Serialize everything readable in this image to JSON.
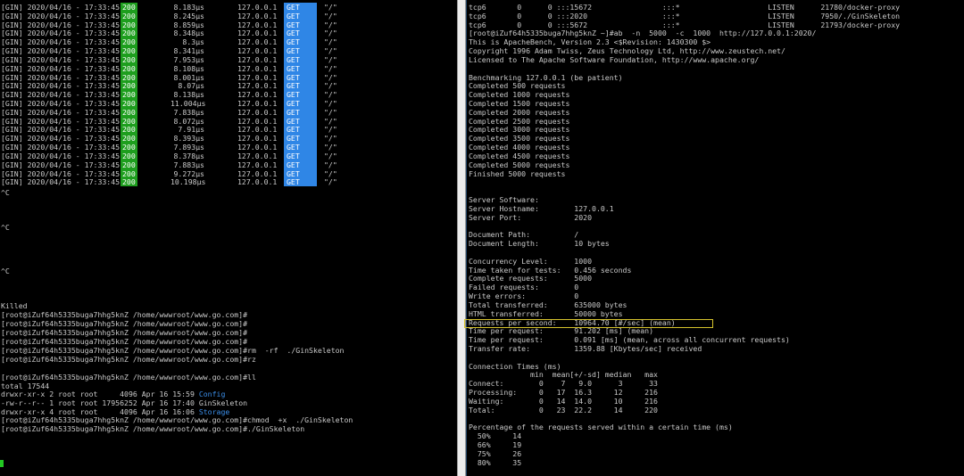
{
  "left_pane": {
    "gin_rows": [
      {
        "prefix": "[GIN] 2020/04/16 - 17:33:45 |",
        "status": "200",
        "latency": "8.183µs",
        "ip": "127.0.0.1",
        "method": "GET",
        "path": "\"/\""
      },
      {
        "prefix": "[GIN] 2020/04/16 - 17:33:45 |",
        "status": "200",
        "latency": "8.245µs",
        "ip": "127.0.0.1",
        "method": "GET",
        "path": "\"/\""
      },
      {
        "prefix": "[GIN] 2020/04/16 - 17:33:45 |",
        "status": "200",
        "latency": "8.859µs",
        "ip": "127.0.0.1",
        "method": "GET",
        "path": "\"/\""
      },
      {
        "prefix": "[GIN] 2020/04/16 - 17:33:45 |",
        "status": "200",
        "latency": "8.348µs",
        "ip": "127.0.0.1",
        "method": "GET",
        "path": "\"/\""
      },
      {
        "prefix": "[GIN] 2020/04/16 - 17:33:45 |",
        "status": "200",
        "latency": "8.3µs",
        "ip": "127.0.0.1",
        "method": "GET",
        "path": "\"/\""
      },
      {
        "prefix": "[GIN] 2020/04/16 - 17:33:45 |",
        "status": "200",
        "latency": "8.341µs",
        "ip": "127.0.0.1",
        "method": "GET",
        "path": "\"/\""
      },
      {
        "prefix": "[GIN] 2020/04/16 - 17:33:45 |",
        "status": "200",
        "latency": "7.953µs",
        "ip": "127.0.0.1",
        "method": "GET",
        "path": "\"/\""
      },
      {
        "prefix": "[GIN] 2020/04/16 - 17:33:45 |",
        "status": "200",
        "latency": "8.108µs",
        "ip": "127.0.0.1",
        "method": "GET",
        "path": "\"/\""
      },
      {
        "prefix": "[GIN] 2020/04/16 - 17:33:45 |",
        "status": "200",
        "latency": "8.001µs",
        "ip": "127.0.0.1",
        "method": "GET",
        "path": "\"/\""
      },
      {
        "prefix": "[GIN] 2020/04/16 - 17:33:45 |",
        "status": "200",
        "latency": "8.07µs",
        "ip": "127.0.0.1",
        "method": "GET",
        "path": "\"/\""
      },
      {
        "prefix": "[GIN] 2020/04/16 - 17:33:45 |",
        "status": "200",
        "latency": "8.138µs",
        "ip": "127.0.0.1",
        "method": "GET",
        "path": "\"/\""
      },
      {
        "prefix": "[GIN] 2020/04/16 - 17:33:45 |",
        "status": "200",
        "latency": "11.004µs",
        "ip": "127.0.0.1",
        "method": "GET",
        "path": "\"/\""
      },
      {
        "prefix": "[GIN] 2020/04/16 - 17:33:45 |",
        "status": "200",
        "latency": "7.838µs",
        "ip": "127.0.0.1",
        "method": "GET",
        "path": "\"/\""
      },
      {
        "prefix": "[GIN] 2020/04/16 - 17:33:45 |",
        "status": "200",
        "latency": "8.072µs",
        "ip": "127.0.0.1",
        "method": "GET",
        "path": "\"/\""
      },
      {
        "prefix": "[GIN] 2020/04/16 - 17:33:45 |",
        "status": "200",
        "latency": "7.91µs",
        "ip": "127.0.0.1",
        "method": "GET",
        "path": "\"/\""
      },
      {
        "prefix": "[GIN] 2020/04/16 - 17:33:45 |",
        "status": "200",
        "latency": "8.393µs",
        "ip": "127.0.0.1",
        "method": "GET",
        "path": "\"/\""
      },
      {
        "prefix": "[GIN] 2020/04/16 - 17:33:45 |",
        "status": "200",
        "latency": "7.893µs",
        "ip": "127.0.0.1",
        "method": "GET",
        "path": "\"/\""
      },
      {
        "prefix": "[GIN] 2020/04/16 - 17:33:45 |",
        "status": "200",
        "latency": "8.378µs",
        "ip": "127.0.0.1",
        "method": "GET",
        "path": "\"/\""
      },
      {
        "prefix": "[GIN] 2020/04/16 - 17:33:45 |",
        "status": "200",
        "latency": "7.883µs",
        "ip": "127.0.0.1",
        "method": "GET",
        "path": "\"/\""
      },
      {
        "prefix": "[GIN] 2020/04/16 - 17:33:45 |",
        "status": "200",
        "latency": "9.272µs",
        "ip": "127.0.0.1",
        "method": "GET",
        "path": "\"/\""
      },
      {
        "prefix": "[GIN] 2020/04/16 - 17:33:45 |",
        "status": "200",
        "latency": "10.198µs",
        "ip": "127.0.0.1",
        "method": "GET",
        "path": "\"/\""
      }
    ],
    "interrupt_1": "^C",
    "interrupt_2": "^C",
    "interrupt_3": "^C",
    "killed": "Killed",
    "prompts": [
      "[root@iZuf64h5335buga7hhg5knZ /home/wwwroot/www.go.com]#",
      "[root@iZuf64h5335buga7hhg5knZ /home/wwwroot/www.go.com]#",
      "[root@iZuf64h5335buga7hhg5knZ /home/wwwroot/www.go.com]#",
      "[root@iZuf64h5335buga7hhg5knZ /home/wwwroot/www.go.com]#",
      "[root@iZuf64h5335buga7hhg5knZ /home/wwwroot/www.go.com]#rm  -rf  ./GinSkeleton",
      "[root@iZuf64h5335buga7hhg5knZ /home/wwwroot/www.go.com]#rz"
    ],
    "ll_prompt": "[root@iZuf64h5335buga7hhg5knZ /home/wwwroot/www.go.com]#ll",
    "total": "total 17544",
    "listing": [
      {
        "meta": "drwxr-xr-x 2 root root     4096 Apr 16 15:59 ",
        "name": "Config"
      },
      {
        "meta": "-rw-r--r-- 1 root root 17956252 Apr 16 17:40 ",
        "name": "GinSkeleton"
      },
      {
        "meta": "drwxr-xr-x 4 root root     4096 Apr 16 16:06 ",
        "name": "Storage"
      }
    ],
    "chmod_prompt": "[root@iZuf64h5335buga7hhg5knZ /home/wwwroot/www.go.com]#chmod  +x  ./GinSkeleton",
    "run_prompt": "[root@iZuf64h5335buga7hhg5knZ /home/wwwroot/www.go.com]#./GinSkeleton"
  },
  "right_pane": {
    "lines": [
      "tcp6       0      0 :::15672                :::*                    LISTEN      21780/docker-proxy",
      "tcp6       0      0 :::2020                 :::*                    LISTEN      7950/./GinSkeleton",
      "tcp6       0      0 :::5672                 :::*                    LISTEN      21793/docker-proxy",
      "[root@iZuf64h5335buga7hhg5knZ ~]#ab  -n  5000  -c  1000  http://127.0.0.1:2020/",
      "This is ApacheBench, Version 2.3 <$Revision: 1430300 $>",
      "Copyright 1996 Adam Twiss, Zeus Technology Ltd, http://www.zeustech.net/",
      "Licensed to The Apache Software Foundation, http://www.apache.org/",
      "",
      "Benchmarking 127.0.0.1 (be patient)",
      "Completed 500 requests",
      "Completed 1000 requests",
      "Completed 1500 requests",
      "Completed 2000 requests",
      "Completed 2500 requests",
      "Completed 3000 requests",
      "Completed 3500 requests",
      "Completed 4000 requests",
      "Completed 4500 requests",
      "Completed 5000 requests",
      "Finished 5000 requests",
      "",
      "",
      "Server Software:",
      "Server Hostname:        127.0.0.1",
      "Server Port:            2020",
      "",
      "Document Path:          /",
      "Document Length:        10 bytes",
      "",
      "Concurrency Level:      1000",
      "Time taken for tests:   0.456 seconds",
      "Complete requests:      5000",
      "Failed requests:        0",
      "Write errors:           0",
      "Total transferred:      635000 bytes",
      "HTML transferred:       50000 bytes",
      "Requests per second:    10964.70 [#/sec] (mean)",
      "Time per request:       91.202 [ms] (mean)",
      "Time per request:       0.091 [ms] (mean, across all concurrent requests)",
      "Transfer rate:          1359.88 [Kbytes/sec] received",
      "",
      "Connection Times (ms)",
      "              min  mean[+/-sd] median   max",
      "Connect:        0    7   9.0      3      33",
      "Processing:     0   17  16.3     12     216",
      "Waiting:        0   14  14.0     10     216",
      "Total:          0   23  22.2     14     220",
      "",
      "Percentage of the requests served within a certain time (ms)",
      "  50%     14",
      "  66%     19",
      "  75%     26",
      "  80%     35"
    ]
  },
  "colors": {
    "background": "#000000",
    "text": "#c9c9c9",
    "status_green": "#1e9e1e",
    "method_blue": "#2f86e6",
    "dir_blue": "#3b8ee8",
    "highlight_yellow": "#d6c32d",
    "cursor_green": "#22c822"
  }
}
